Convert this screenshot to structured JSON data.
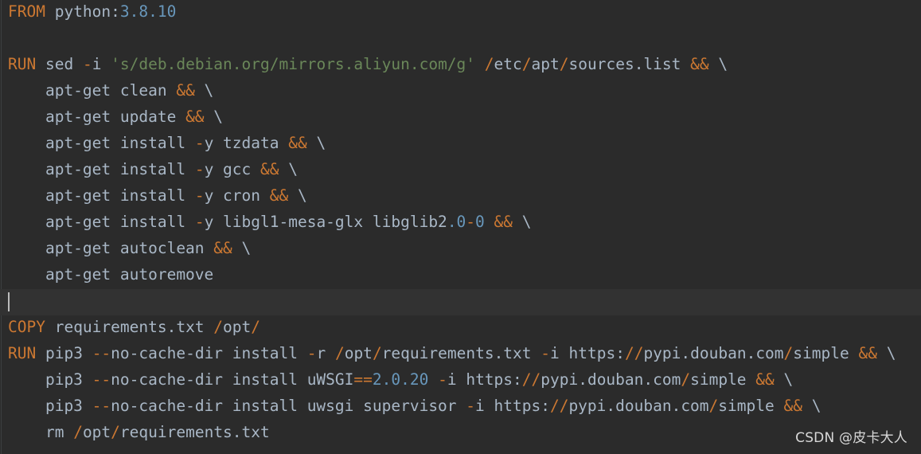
{
  "editor": {
    "background": "#2b2b2b",
    "colors": {
      "keyword": "#cc7832",
      "operator": "#cc7832",
      "string": "#6a8759",
      "number": "#6897bb",
      "text": "#a9b7c6"
    },
    "lines": [
      {
        "tokens": [
          {
            "t": "FROM",
            "c": "kw"
          },
          {
            "t": " python:",
            "c": "plain"
          },
          {
            "t": "3.8.10",
            "c": "num"
          }
        ]
      },
      {
        "tokens": []
      },
      {
        "tokens": [
          {
            "t": "RUN",
            "c": "kw"
          },
          {
            "t": " sed ",
            "c": "plain"
          },
          {
            "t": "-",
            "c": "op"
          },
          {
            "t": "i ",
            "c": "plain"
          },
          {
            "t": "'s/deb.debian.org/mirrors.aliyun.com/g'",
            "c": "str"
          },
          {
            "t": " ",
            "c": "plain"
          },
          {
            "t": "/",
            "c": "op"
          },
          {
            "t": "etc",
            "c": "plain"
          },
          {
            "t": "/",
            "c": "op"
          },
          {
            "t": "apt",
            "c": "plain"
          },
          {
            "t": "/",
            "c": "op"
          },
          {
            "t": "sources.list ",
            "c": "plain"
          },
          {
            "t": "&&",
            "c": "op"
          },
          {
            "t": " \\",
            "c": "plain"
          }
        ]
      },
      {
        "tokens": [
          {
            "t": "    apt-get clean ",
            "c": "plain"
          },
          {
            "t": "&&",
            "c": "op"
          },
          {
            "t": " \\",
            "c": "plain"
          }
        ]
      },
      {
        "tokens": [
          {
            "t": "    apt-get update ",
            "c": "plain"
          },
          {
            "t": "&&",
            "c": "op"
          },
          {
            "t": " \\",
            "c": "plain"
          }
        ]
      },
      {
        "tokens": [
          {
            "t": "    apt-get install ",
            "c": "plain"
          },
          {
            "t": "-",
            "c": "op"
          },
          {
            "t": "y tzdata ",
            "c": "plain"
          },
          {
            "t": "&&",
            "c": "op"
          },
          {
            "t": " \\",
            "c": "plain"
          }
        ]
      },
      {
        "tokens": [
          {
            "t": "    apt-get install ",
            "c": "plain"
          },
          {
            "t": "-",
            "c": "op"
          },
          {
            "t": "y gcc ",
            "c": "plain"
          },
          {
            "t": "&&",
            "c": "op"
          },
          {
            "t": " \\",
            "c": "plain"
          }
        ]
      },
      {
        "tokens": [
          {
            "t": "    apt-get install ",
            "c": "plain"
          },
          {
            "t": "-",
            "c": "op"
          },
          {
            "t": "y cron ",
            "c": "plain"
          },
          {
            "t": "&&",
            "c": "op"
          },
          {
            "t": " \\",
            "c": "plain"
          }
        ]
      },
      {
        "tokens": [
          {
            "t": "    apt-get install ",
            "c": "plain"
          },
          {
            "t": "-",
            "c": "op"
          },
          {
            "t": "y libgl1-mesa-glx libglib2",
            "c": "plain"
          },
          {
            "t": ".0",
            "c": "num"
          },
          {
            "t": "-",
            "c": "op"
          },
          {
            "t": "0",
            "c": "num"
          },
          {
            "t": " ",
            "c": "plain"
          },
          {
            "t": "&&",
            "c": "op"
          },
          {
            "t": " \\",
            "c": "plain"
          }
        ]
      },
      {
        "tokens": [
          {
            "t": "    apt-get autoclean ",
            "c": "plain"
          },
          {
            "t": "&&",
            "c": "op"
          },
          {
            "t": " \\",
            "c": "plain"
          }
        ]
      },
      {
        "tokens": [
          {
            "t": "    apt-get autoremove",
            "c": "plain"
          }
        ]
      },
      {
        "tokens": [],
        "current": true
      },
      {
        "tokens": [
          {
            "t": "COPY",
            "c": "kw"
          },
          {
            "t": " requirements.txt ",
            "c": "plain"
          },
          {
            "t": "/",
            "c": "op"
          },
          {
            "t": "opt",
            "c": "plain"
          },
          {
            "t": "/",
            "c": "op"
          }
        ]
      },
      {
        "tokens": [
          {
            "t": "RUN",
            "c": "kw"
          },
          {
            "t": " pip3 ",
            "c": "plain"
          },
          {
            "t": "--",
            "c": "op"
          },
          {
            "t": "no-cache-dir install ",
            "c": "plain"
          },
          {
            "t": "-",
            "c": "op"
          },
          {
            "t": "r ",
            "c": "plain"
          },
          {
            "t": "/",
            "c": "op"
          },
          {
            "t": "opt",
            "c": "plain"
          },
          {
            "t": "/",
            "c": "op"
          },
          {
            "t": "requirements.txt ",
            "c": "plain"
          },
          {
            "t": "-",
            "c": "op"
          },
          {
            "t": "i https:",
            "c": "plain"
          },
          {
            "t": "//",
            "c": "op"
          },
          {
            "t": "pypi.douban.com",
            "c": "plain"
          },
          {
            "t": "/",
            "c": "op"
          },
          {
            "t": "simple ",
            "c": "plain"
          },
          {
            "t": "&&",
            "c": "op"
          },
          {
            "t": " \\",
            "c": "plain"
          }
        ]
      },
      {
        "tokens": [
          {
            "t": "    pip3 ",
            "c": "plain"
          },
          {
            "t": "--",
            "c": "op"
          },
          {
            "t": "no-cache-dir install uWSGI",
            "c": "plain"
          },
          {
            "t": "==",
            "c": "op"
          },
          {
            "t": "2.0.20",
            "c": "num"
          },
          {
            "t": " ",
            "c": "plain"
          },
          {
            "t": "-",
            "c": "op"
          },
          {
            "t": "i https:",
            "c": "plain"
          },
          {
            "t": "//",
            "c": "op"
          },
          {
            "t": "pypi.douban.com",
            "c": "plain"
          },
          {
            "t": "/",
            "c": "op"
          },
          {
            "t": "simple ",
            "c": "plain"
          },
          {
            "t": "&&",
            "c": "op"
          },
          {
            "t": " \\",
            "c": "plain"
          }
        ]
      },
      {
        "tokens": [
          {
            "t": "    pip3 ",
            "c": "plain"
          },
          {
            "t": "--",
            "c": "op"
          },
          {
            "t": "no-cache-dir install uwsgi supervisor ",
            "c": "plain"
          },
          {
            "t": "-",
            "c": "op"
          },
          {
            "t": "i https:",
            "c": "plain"
          },
          {
            "t": "//",
            "c": "op"
          },
          {
            "t": "pypi.douban.com",
            "c": "plain"
          },
          {
            "t": "/",
            "c": "op"
          },
          {
            "t": "simple ",
            "c": "plain"
          },
          {
            "t": "&&",
            "c": "op"
          },
          {
            "t": " \\",
            "c": "plain"
          }
        ]
      },
      {
        "tokens": [
          {
            "t": "    rm ",
            "c": "plain"
          },
          {
            "t": "/",
            "c": "op"
          },
          {
            "t": "opt",
            "c": "plain"
          },
          {
            "t": "/",
            "c": "op"
          },
          {
            "t": "requirements.txt",
            "c": "plain"
          }
        ]
      }
    ]
  },
  "watermark": "CSDN @皮卡大人"
}
